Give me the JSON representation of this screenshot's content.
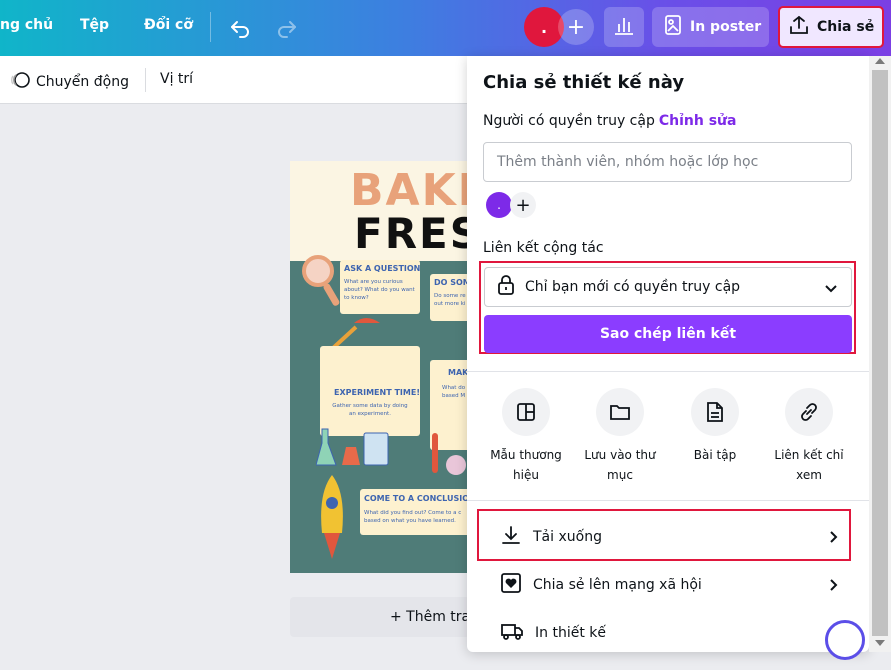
{
  "topbar": {
    "nav": [
      "ng chủ",
      "Tệp",
      "Đổi cỡ"
    ],
    "avatar_text": ".",
    "add_label": "+",
    "print_poster": "In poster",
    "share": "Chia sẻ",
    "icons": [
      "undo-icon",
      "redo-icon",
      "bar-chart-icon",
      "poster-icon",
      "upload-icon"
    ]
  },
  "toolbar": {
    "animate": "Chuyển động",
    "position": "Vị trí"
  },
  "poster": {
    "title1": "BAKE",
    "title2": "FRES",
    "cards": [
      {
        "title": "ASK A QUESTION",
        "text": "What are you curious about? What do you want to know?"
      },
      {
        "title": "DO SOME",
        "text": "Do some re out more ki"
      },
      {
        "title": "EXPERIMENT TIME!",
        "text": "Gather some data by doing an experiment."
      },
      {
        "title": "MAKE",
        "text": "What do based M"
      },
      {
        "title": "COME TO A CONCLUSION",
        "text": "What did you find out? Come to a c based on what you have learned."
      }
    ]
  },
  "canvas": {
    "add_page": "+ Thêm trang"
  },
  "share_panel": {
    "title": "Chia sẻ thiết kế này",
    "access_label": "Người có quyền truy cập",
    "access_edit": "Chỉnh sửa",
    "member_placeholder": "Thêm thành viên, nhóm hoặc lớp học",
    "member_avatar": ".",
    "collab_label": "Liên kết cộng tác",
    "access_option": "Chỉ bạn mới có quyền truy cập",
    "copy_link": "Sao chép liên kết",
    "options": [
      {
        "label": "Mẫu thương hiệu",
        "icon": "brand-template-icon"
      },
      {
        "label": "Lưu vào thư mục",
        "icon": "folder-icon"
      },
      {
        "label": "Bài tập",
        "icon": "assignment-icon"
      },
      {
        "label": "Liên kết chỉ xem",
        "icon": "link-icon"
      }
    ],
    "rows": [
      {
        "label": "Tải xuống",
        "icon": "download-icon"
      },
      {
        "label": "Chia sẻ lên mạng xã hội",
        "icon": "heart-icon"
      },
      {
        "label": "In thiết kế",
        "icon": "truck-icon"
      }
    ]
  },
  "colors": {
    "accent": "#8b3dff",
    "highlight": "#e0173d",
    "edit_link": "#7d2ae8"
  }
}
